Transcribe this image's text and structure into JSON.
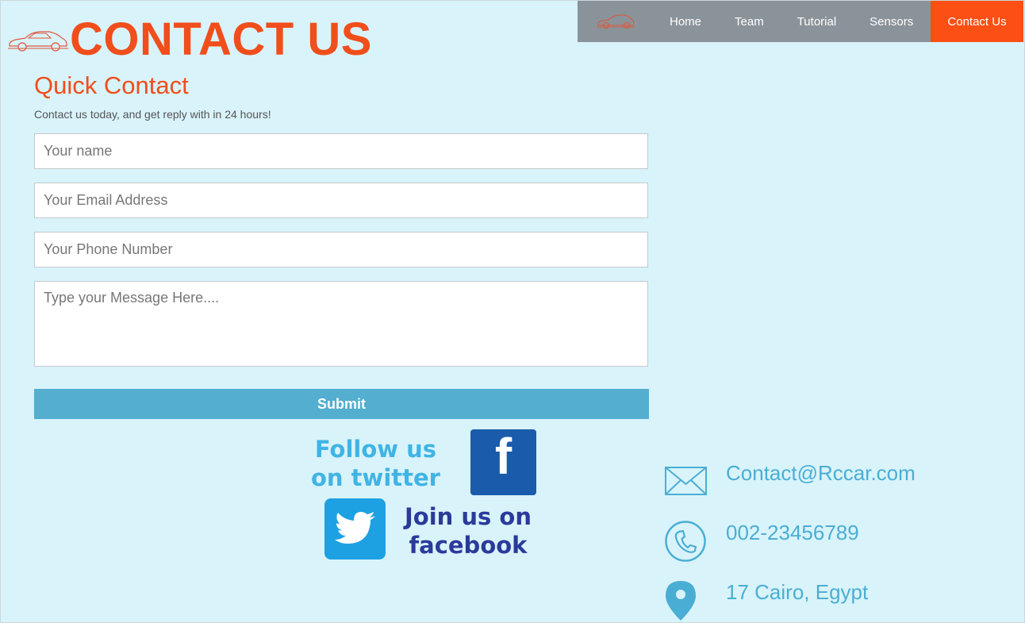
{
  "header": {
    "title": "CONTACT US"
  },
  "nav": {
    "items": [
      {
        "label": "Home"
      },
      {
        "label": "Team"
      },
      {
        "label": "Tutorial"
      },
      {
        "label": "Sensors"
      },
      {
        "label": "Contact Us",
        "active": true
      }
    ]
  },
  "quick_contact": {
    "title": "Quick Contact",
    "subtitle": "Contact us today, and get reply with in 24 hours!"
  },
  "form": {
    "name_placeholder": "Your name",
    "email_placeholder": "Your Email Address",
    "phone_placeholder": "Your Phone Number",
    "message_placeholder": "Type your Message Here....",
    "submit_label": "Submit"
  },
  "social": {
    "twitter_line1": "Follow us",
    "twitter_line2": "on twitter",
    "facebook_line1": "Join us on",
    "facebook_line2": "facebook",
    "facebook_icon_glyph": "f"
  },
  "contact_info": {
    "email": "Contact@Rccar.com",
    "phone": "002-23456789",
    "address": "17 Cairo, Egypt"
  },
  "colors": {
    "background": "#d9f3fb",
    "accent": "#f04e1b",
    "nav_bg": "#8a9399",
    "nav_active": "#fb4f14",
    "submit_bg": "#53aed0",
    "info_text": "#4aaed4"
  }
}
